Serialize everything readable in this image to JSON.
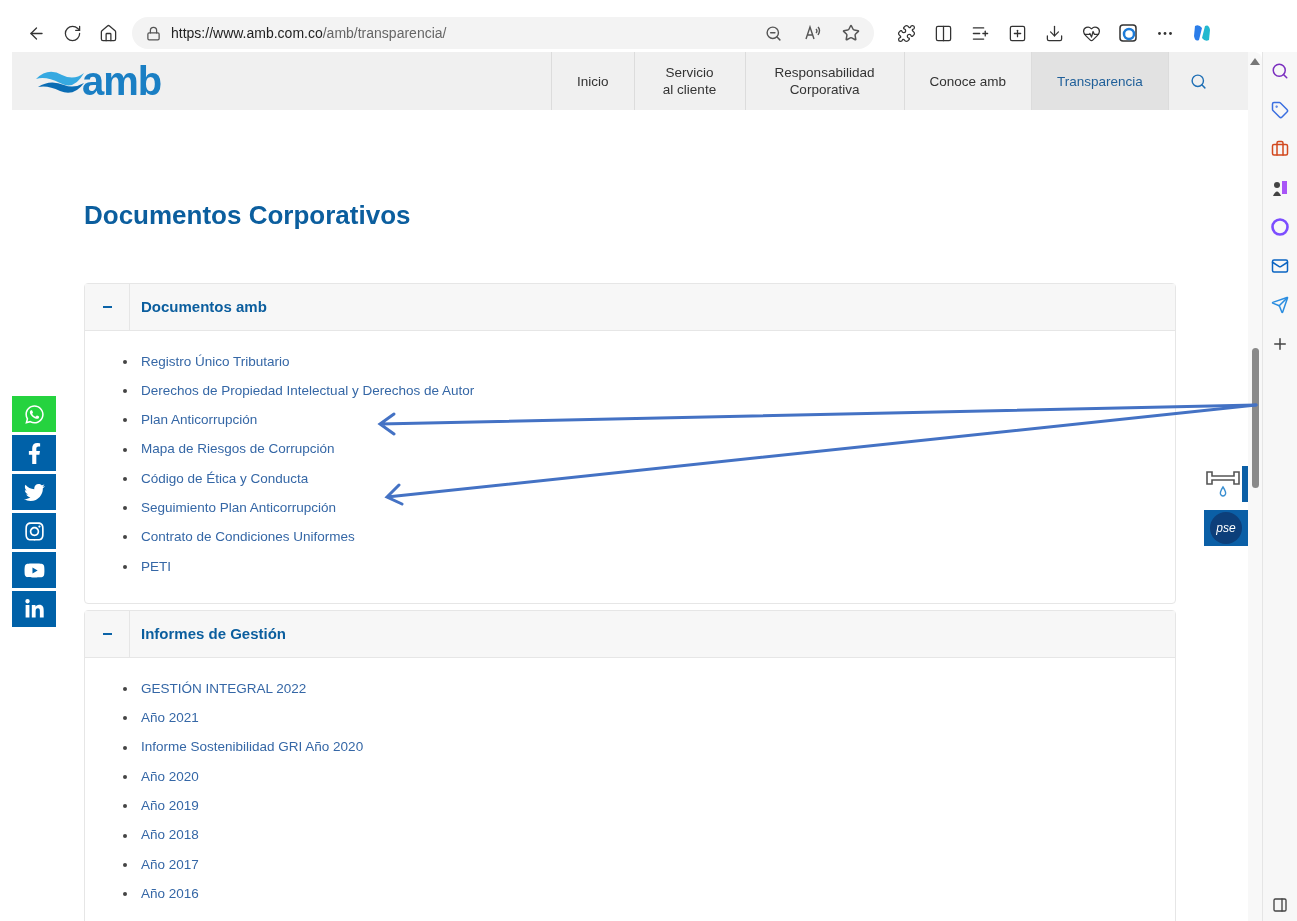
{
  "browser": {
    "url_host": "https://www.amb.com.co",
    "url_path": "/amb/transparencia/"
  },
  "nav": [
    {
      "label": "Inicio",
      "selected": false
    },
    {
      "label": "Servicio al cliente",
      "selected": false
    },
    {
      "label": "Responsabilidad Corporativa",
      "selected": false
    },
    {
      "label": "Conoce amb",
      "selected": false
    },
    {
      "label": "Transparencia",
      "selected": true
    }
  ],
  "logo": "amb",
  "title": "Documentos Corporativos",
  "sections": [
    {
      "title": "Documentos amb",
      "expanded": true,
      "items": [
        "Registro Único Tributario",
        "Derechos de Propiedad Intelectual y Derechos de Autor",
        "Plan Anticorrupción",
        "Mapa de Riesgos de Corrupción",
        "Código de Ética y Conducta",
        "Seguimiento Plan Anticorrupción",
        "Contrato de Condiciones Uniformes",
        "PETI"
      ]
    },
    {
      "title": "Informes de Gestión",
      "expanded": true,
      "items": [
        "GESTIÓN INTEGRAL 2022",
        "Año 2021",
        "Informe Sostenibilidad GRI Año 2020",
        "Año 2020",
        "Año 2019",
        "Año 2018",
        "Año 2017",
        "Año 2016"
      ]
    }
  ],
  "social": [
    {
      "kind": "whatsapp",
      "color": "#25d33f"
    },
    {
      "kind": "facebook",
      "color": "#0061a8"
    },
    {
      "kind": "twitter",
      "color": "#0061a8"
    },
    {
      "kind": "instagram",
      "color": "#0061a8"
    },
    {
      "kind": "youtube",
      "color": "#0061a8"
    },
    {
      "kind": "linkedin",
      "color": "#0061a8"
    }
  ],
  "pse_label": "pse"
}
